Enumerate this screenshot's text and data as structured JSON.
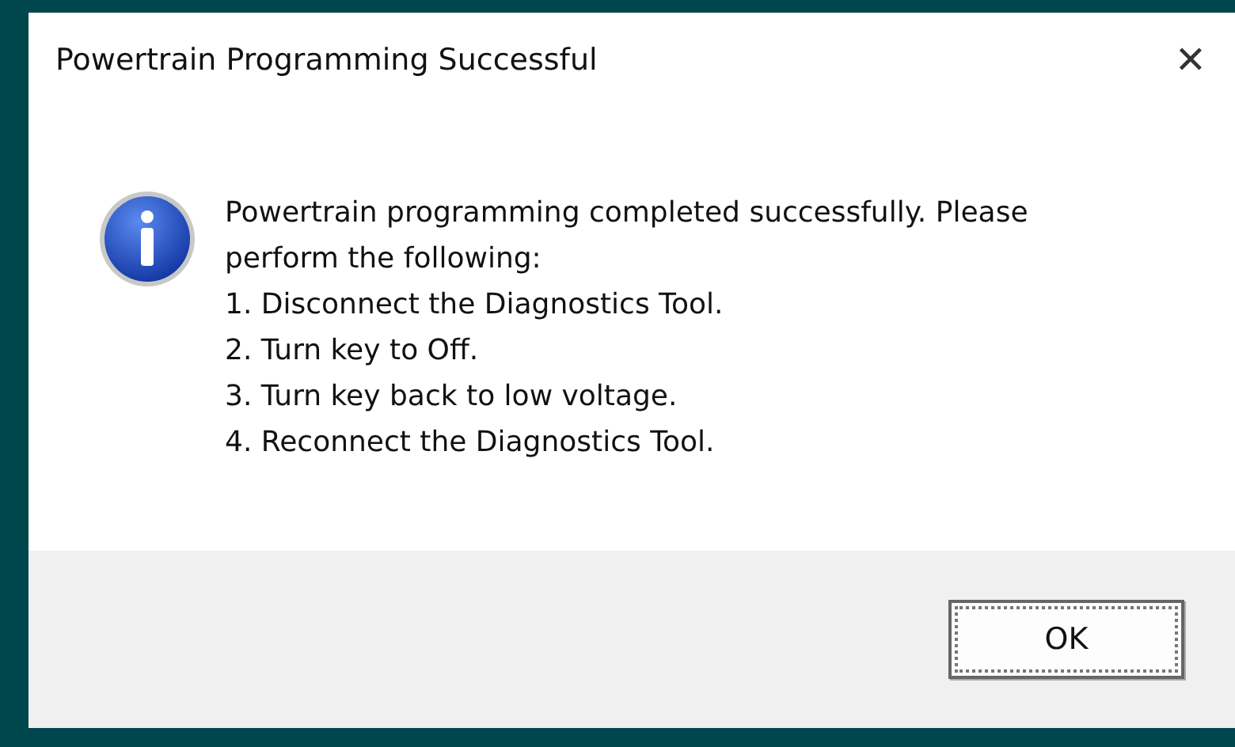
{
  "window": {
    "title": "Powertrain Programming Successful",
    "close": "✕"
  },
  "message": "Powertrain programming completed successfully. Please perform the following:",
  "steps": [
    "1. Disconnect the Diagnostics Tool.",
    "2. Turn key to Off.",
    "3. Turn key back to low voltage.",
    "4. Reconnect the Diagnostics Tool."
  ],
  "buttons": [
    {
      "label": "OK",
      "focused": true
    }
  ]
}
